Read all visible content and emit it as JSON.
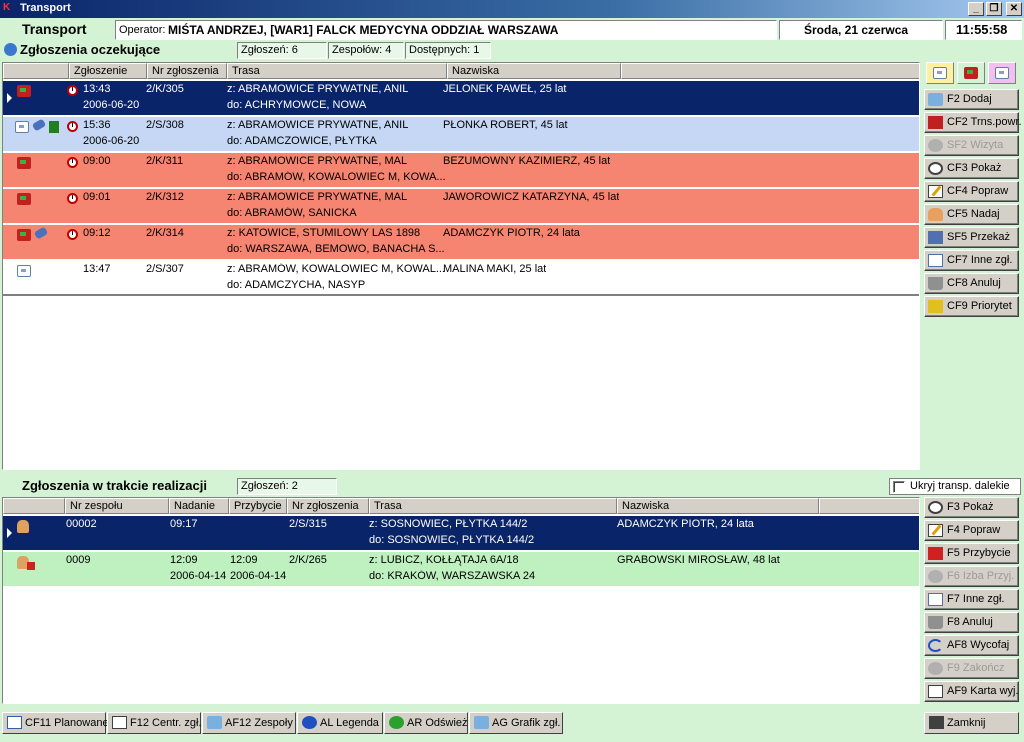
{
  "window": {
    "title": "Transport"
  },
  "header": {
    "app_label": "Transport",
    "operator_prefix": "Operator:",
    "operator_value": "MIŚTA ANDRZEJ,  [WAR1] FALCK MEDYCYNA ODDZIAŁ WARSZAWA",
    "date": "Środa, 21 czerwca",
    "time": "11:55:58"
  },
  "pending": {
    "title": "Zgłoszenia oczekujące",
    "counts": {
      "zgloszen": "Zgłoszeń: 6",
      "zespolow": "Zespołów: 4",
      "dostepnych": "Dostępnych: 1"
    },
    "columns": [
      "Zgłoszenie",
      "Nr zgłoszenia",
      "Trasa",
      "Nazwiska"
    ],
    "rows": [
      {
        "time": "13:43",
        "date": "2006-06-20",
        "nr": "2/K/305",
        "route_from": "z: ABRAMOWICE PRYWATNE, ANIL",
        "route_to": "do: ACHRYMOWCE, NOWA",
        "name": "JELONEK PAWEŁ, 25 lat"
      },
      {
        "time": "15:36",
        "date": "2006-06-20",
        "nr": "2/S/308",
        "route_from": "z: ABRAMOWICE PRYWATNE, ANIL",
        "route_to": "do: ADAMCZOWICE, PŁYTKA",
        "name": "PŁONKA ROBERT, 45 lat"
      },
      {
        "time": "09:00",
        "date": "",
        "nr": "2/K/311",
        "route_from": "z: ABRAMOWICE PRYWATNE, MAL",
        "route_to": "do: ABRAMÓW, KOWALOWIEC M, KOWA...",
        "name": "BEZUMOWNY KAZIMIERZ, 45 lat"
      },
      {
        "time": "09:01",
        "date": "",
        "nr": "2/K/312",
        "route_from": "z: ABRAMOWICE PRYWATNE, MAL",
        "route_to": "do: ABRAMÓW, SANICKA",
        "name": "JAWOROWICZ KATARZYNA, 45 lat"
      },
      {
        "time": "09:12",
        "date": "",
        "nr": "2/K/314",
        "route_from": "z: KATOWICE, STUMILOWY LAS 1898",
        "route_to": "do: WARSZAWA, BEMOWO, BANACHA S...",
        "name": "ADAMCZYK PIOTR, 24 lata"
      },
      {
        "time": "13:47",
        "date": "",
        "nr": "2/S/307",
        "route_from": "z: ABRAMÓW, KOWALOWIEC M, KOWAL...",
        "route_to": "do: ADAMCZYCHA, NASYP",
        "name": "MALINA MAKI, 25 lat"
      }
    ]
  },
  "pending_buttons": [
    "F2 Dodaj",
    "CF2 Trns.powr.",
    "SF2 Wizyta",
    "CF3 Pokaż",
    "CF4 Popraw",
    "CF5 Nadaj",
    "SF5 Przekaż",
    "CF7 Inne zgł.",
    "CF8 Anuluj",
    "CF9 Priorytet"
  ],
  "active": {
    "title": "Zgłoszenia w trakcie realizacji",
    "count": "Zgłoszeń: 2",
    "hide_long_label": "Ukryj transp. dalekie",
    "columns": [
      "Nr zespołu",
      "Nadanie",
      "Przybycie",
      "Nr zgłoszenia",
      "Trasa",
      "Nazwiska"
    ],
    "rows": [
      {
        "team": "00002",
        "assigned": "09:17",
        "assigned_date": "",
        "arrived": "",
        "arrived_date": "",
        "nr": "2/S/315",
        "route_from": "z: SOSNOWIEC, PŁYTKA 144/2",
        "route_to": "do: SOSNOWIEC, PŁYTKA 144/2",
        "name": "ADAMCZYK PIOTR, 24 lata"
      },
      {
        "team": "0009",
        "assigned": "12:09",
        "assigned_date": "2006-04-14",
        "arrived": "12:09",
        "arrived_date": "2006-04-14",
        "nr": "2/K/265",
        "route_from": "z: LUBICZ, KOŁŁĄTAJA 6A/18",
        "route_to": "do: KRAKÓW, WARSZAWSKA 24",
        "name": "GRABOWSKI MIROSŁAW, 48 lat"
      }
    ]
  },
  "active_buttons": [
    "F3 Pokaż",
    "F4 Popraw",
    "F5 Przybycie",
    "F6 Izba Przyj.",
    "F7 Inne zgł.",
    "F8 Anuluj",
    "AF8 Wycofaj",
    "F9 Zakończ",
    "AF9 Karta wyj."
  ],
  "toolbar": [
    "CF11 Planowane",
    "F12 Centr. zgł.",
    "AF12 Zespoły",
    "AL Legenda",
    "AR Odśwież",
    "AG Grafik zgł."
  ],
  "close_label": "Zamknij",
  "colors": {
    "selected_row": "#0a246a",
    "urgent_row": "#f58470",
    "planned_row": "#c5d7f5",
    "active_row": "#bff0bf",
    "background": "#d4f2d4"
  }
}
